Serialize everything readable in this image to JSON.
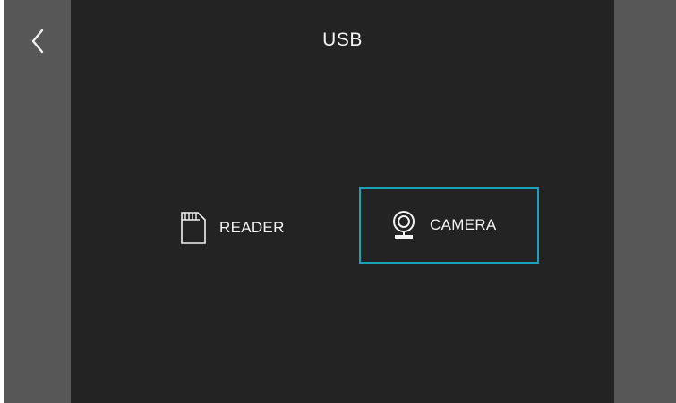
{
  "header": {
    "title": "USB",
    "back_icon": "chevron-left-icon"
  },
  "options": [
    {
      "id": "reader",
      "label": "READER",
      "icon": "sd-card-icon",
      "selected": false
    },
    {
      "id": "camera",
      "label": "CAMERA",
      "icon": "webcam-icon",
      "selected": true
    }
  ],
  "colors": {
    "background": "#232323",
    "side_bars": "#575757",
    "text": "#f2f2f2",
    "selection_border": "#1aa3b4"
  }
}
